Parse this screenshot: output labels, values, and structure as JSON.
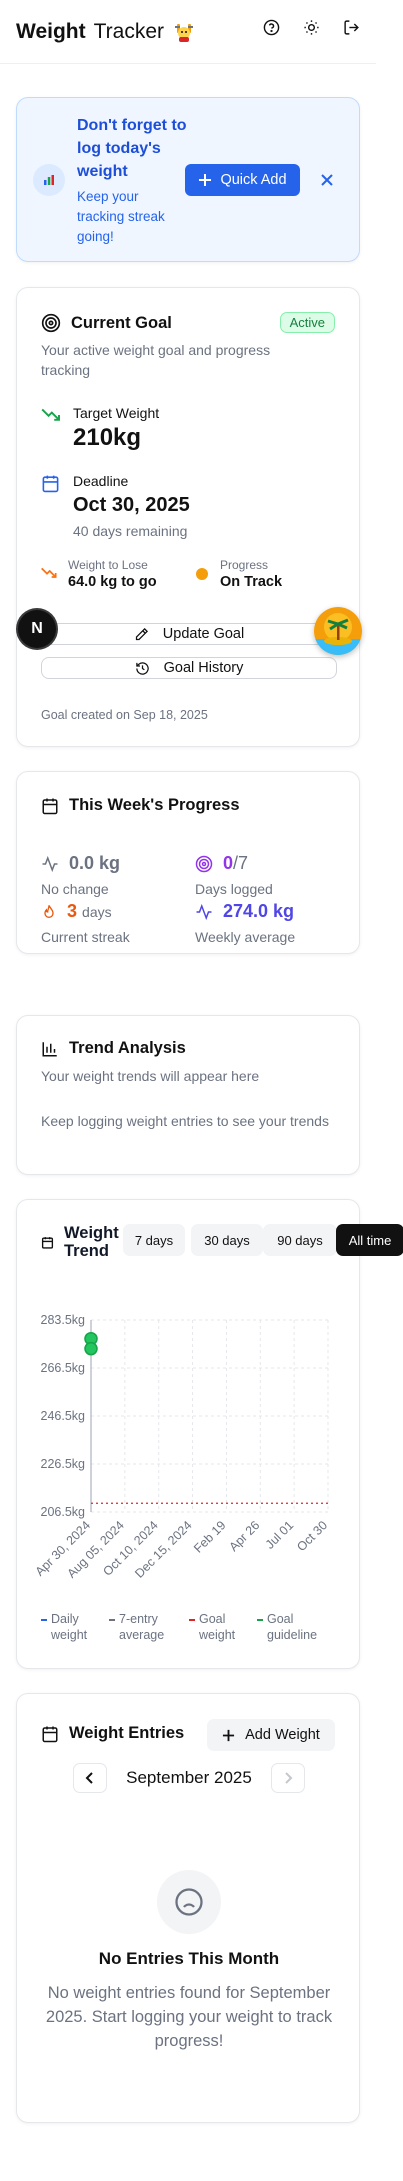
{
  "header": {
    "title_bold": "Weight",
    "title_thin": "Tracker",
    "icons": [
      "help-icon",
      "sun-icon",
      "logout-icon"
    ]
  },
  "reminder": {
    "title": "Don't forget to log today's weight",
    "subtitle": "Keep your tracking streak going!",
    "quick_add_label": "Quick Add",
    "close_icon": "close-icon"
  },
  "goal": {
    "title": "Current Goal",
    "status": "Active",
    "description": "Your active weight goal and progress tracking",
    "target_label": "Target Weight",
    "target_value": "210kg",
    "deadline_label": "Deadline",
    "deadline_value": "Oct 30, 2025",
    "deadline_remaining": "40 days remaining",
    "to_lose_label": "Weight to Lose",
    "to_lose_value": "64.0 kg to go",
    "progress_label": "Progress",
    "progress_value": "On Track",
    "update_label": "Update Goal",
    "history_label": "Goal History",
    "created": "Goal created on Sep 18, 2025",
    "colors": {
      "accent_green": "#16a34a",
      "accent_orange": "#f59e0b",
      "accent_blue": "#2563eb"
    }
  },
  "weekly": {
    "title": "This Week's Progress",
    "change_value": "0.0 kg",
    "change_label": "No change",
    "days_logged_value": "0",
    "days_logged_total": "/7",
    "days_logged_label": "Days logged",
    "streak_value": "3",
    "streak_unit": "days",
    "streak_label": "Current streak",
    "avg_value": "274.0 kg",
    "avg_label": "Weekly average"
  },
  "trend": {
    "title": "Trend Analysis",
    "subtitle": "Your weight trends will appear here",
    "message": "Keep logging weight entries to see your trends"
  },
  "chart": {
    "title": "Weight Trend",
    "ranges": [
      "7 days",
      "30 days",
      "90 days",
      "All time"
    ],
    "active_range": "All time"
  },
  "chart_data": {
    "type": "line",
    "title": "Weight Trend",
    "y_ticks": [
      "283.5kg",
      "266.5kg",
      "246.5kg",
      "226.5kg",
      "206.5kg"
    ],
    "x_ticks": [
      "Apr 30, 2024",
      "Aug 05, 2024",
      "Oct 10, 2024",
      "Dec 15, 2024",
      "Feb 19",
      "Apr 26",
      "Jul 01",
      "Oct 30"
    ],
    "ylim": [
      206.5,
      283.5
    ],
    "series": [
      {
        "name": "Daily weight",
        "x": [
          "Apr 30, 2024",
          "Apr 30, 2024"
        ],
        "y": [
          276,
          272
        ],
        "color": "#2563eb"
      },
      {
        "name": "7-entry average",
        "x": [],
        "y": [],
        "color": "#6b7280"
      },
      {
        "name": "Goal weight",
        "y_const": 210,
        "color": "#dc2626"
      },
      {
        "name": "Goal guideline",
        "x": [],
        "y": [],
        "color": "#16a34a"
      }
    ],
    "grid": true,
    "legend_position": "bottom"
  },
  "entries": {
    "title": "Weight Entries",
    "add_label": "Add Weight",
    "month": "September 2025",
    "empty_title": "No Entries This Month",
    "empty_desc": "No weight entries found for September 2025. Start logging your weight to track progress!"
  },
  "floating": {
    "badge_letter": "N"
  }
}
